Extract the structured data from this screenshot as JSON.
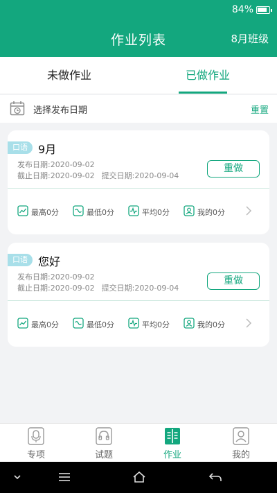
{
  "status_bar": {
    "battery": "84%"
  },
  "header": {
    "title": "作业列表",
    "class_selector": "8月班级"
  },
  "tabs": [
    {
      "label": "未做作业",
      "active": false
    },
    {
      "label": "已做作业",
      "active": true
    }
  ],
  "filter": {
    "date_label": "选择发布日期",
    "reset_label": "重置"
  },
  "assignments": [
    {
      "badge": "口语",
      "title": "9月",
      "publish_label": "发布日期:",
      "publish_date": "2020-09-02",
      "deadline_label": "截止日期:",
      "deadline_date": "2020-09-02",
      "submit_label": "提交日期:",
      "submit_date": "2020-09-04",
      "action_label": "重做",
      "stats": {
        "high": "最高0分",
        "low": "最低0分",
        "avg": "平均0分",
        "mine": "我的0分"
      }
    },
    {
      "badge": "口语",
      "title": "您好",
      "publish_label": "发布日期:",
      "publish_date": "2020-09-02",
      "deadline_label": "截止日期:",
      "deadline_date": "2020-09-02",
      "submit_label": "提交日期:",
      "submit_date": "2020-09-04",
      "action_label": "重做",
      "stats": {
        "high": "最高0分",
        "low": "最低0分",
        "avg": "平均0分",
        "mine": "我的0分"
      }
    }
  ],
  "bottom_nav": [
    {
      "label": "专项",
      "icon": "microphone-icon",
      "active": false
    },
    {
      "label": "试题",
      "icon": "headphones-icon",
      "active": false
    },
    {
      "label": "作业",
      "icon": "book-icon",
      "active": true
    },
    {
      "label": "我的",
      "icon": "profile-icon",
      "active": false
    }
  ],
  "colors": {
    "accent": "#13a77e",
    "badge": "#a8dfe9",
    "background": "#f2f3f5"
  }
}
